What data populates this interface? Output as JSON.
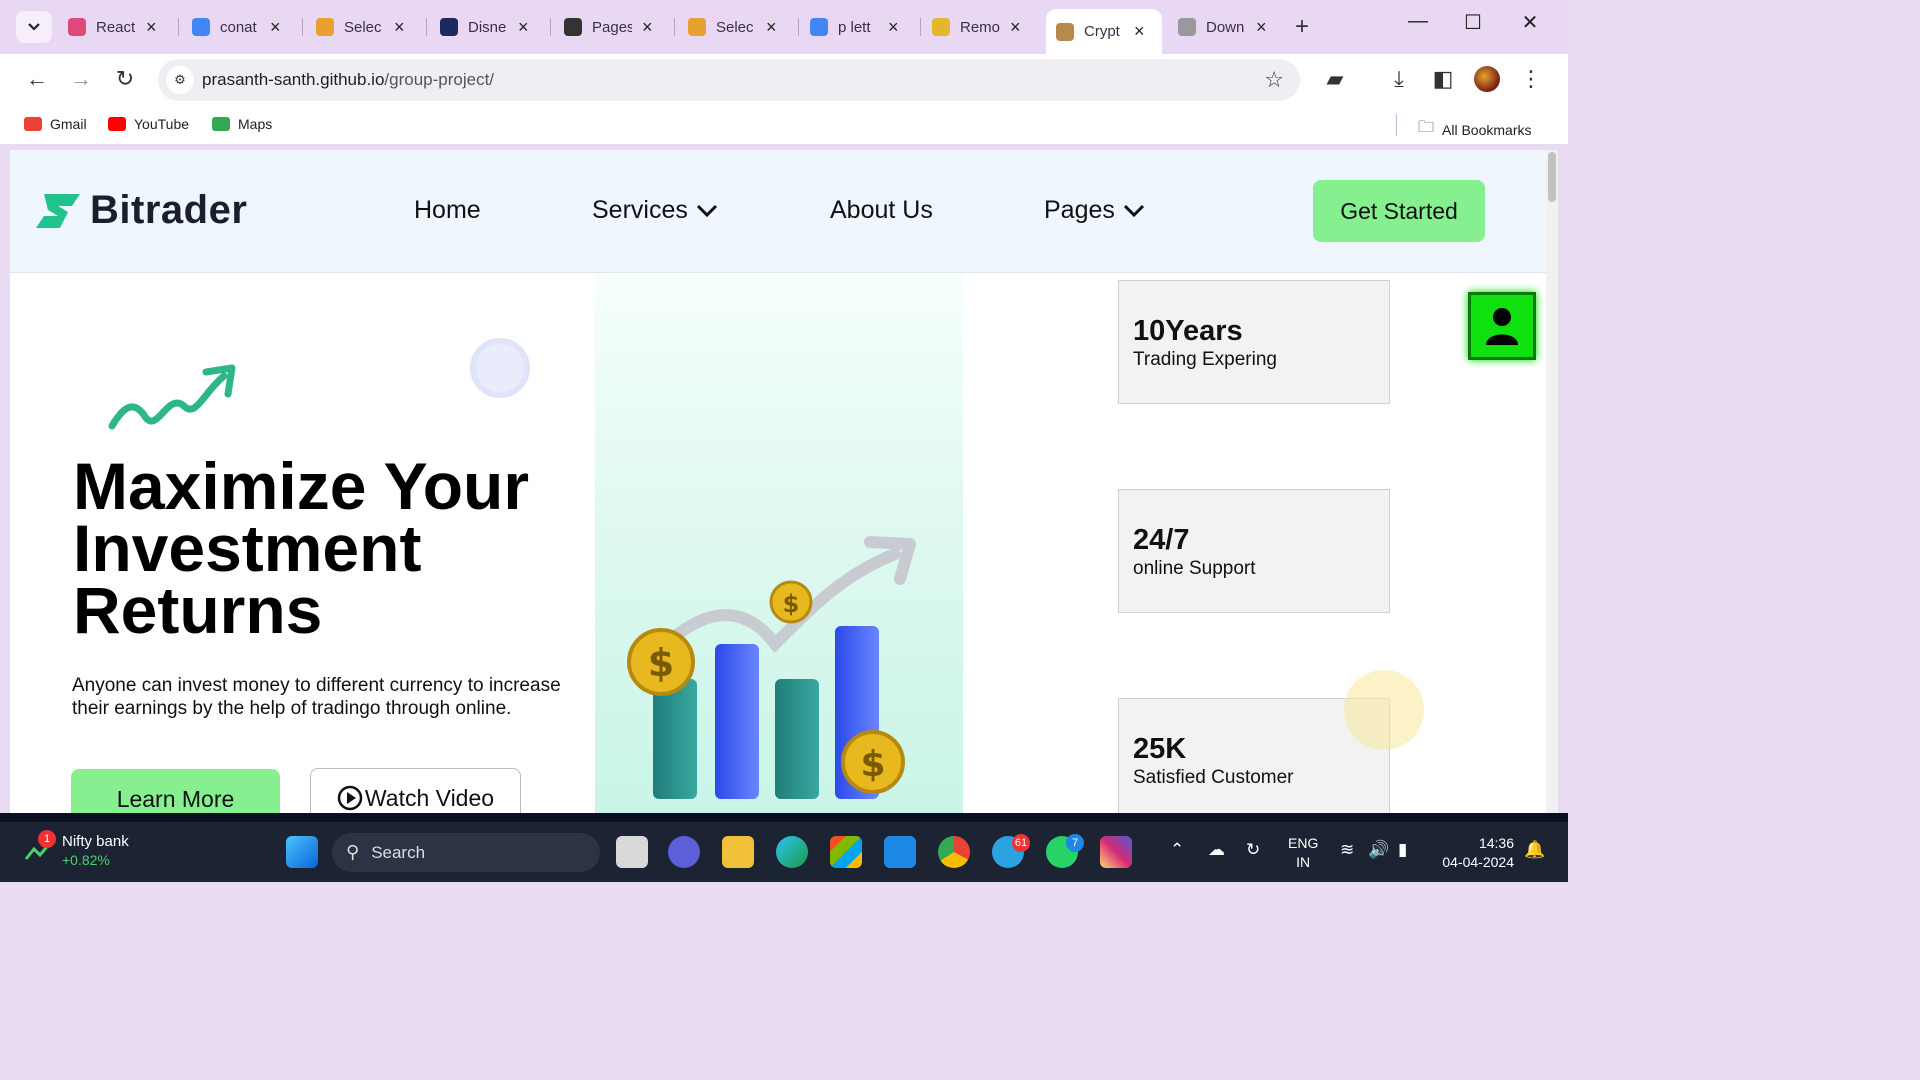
{
  "browser": {
    "tabs": [
      {
        "label": "React",
        "color": "#e0487a"
      },
      {
        "label": "conat",
        "color": "#4285f4"
      },
      {
        "label": "Selec",
        "color": "#e8a030"
      },
      {
        "label": "Disne",
        "color": "#1d2a5e"
      },
      {
        "label": "Pages",
        "color": "#333333"
      },
      {
        "label": "Selec",
        "color": "#e8a030"
      },
      {
        "label": "p lett",
        "color": "#4285f4"
      },
      {
        "label": "Remo",
        "color": "#e4b62c"
      },
      {
        "label": "Crypt",
        "color": "#b68a4a"
      },
      {
        "label": "Down",
        "color": "#999999"
      }
    ],
    "active_tab_index": 8,
    "url_host": "prasanth-santh.github.io",
    "url_path": "/group-project/",
    "bookmarks": [
      {
        "label": "Gmail",
        "color": "#ea4335"
      },
      {
        "label": "YouTube",
        "color": "#ff0000"
      },
      {
        "label": "Maps",
        "color": "#34a853"
      }
    ],
    "all_bookmarks": "All Bookmarks"
  },
  "site": {
    "brand": "Bitrader",
    "brand_color": "#1fc38b",
    "nav": {
      "home": "Home",
      "services": "Services",
      "about": "About Us",
      "pages": "Pages"
    },
    "get_started": "Get Started",
    "accent_color": "#86ef90"
  },
  "hero": {
    "title_line1": "Maximize Your",
    "title_line2": "Investment",
    "title_line3": "Returns",
    "description": "Anyone can invest money to different currency to increase their earnings by the help of tradingo through online.",
    "learn_more": "Learn More",
    "watch_video": "Watch Video"
  },
  "stats": [
    {
      "number": "10Years",
      "label": "Trading Expering"
    },
    {
      "number": "24/7",
      "label": "online Support"
    },
    {
      "number": "25K",
      "label": "Satisfied Customer"
    }
  ],
  "taskbar": {
    "widget_title": "Nifty bank",
    "widget_value": "+0.82%",
    "widget_badge": "1",
    "search": "Search",
    "telegram_badge": "61",
    "whatsapp_badge": "7",
    "lang_line1": "ENG",
    "lang_line2": "IN",
    "time": "14:36",
    "date": "04-04-2024"
  }
}
